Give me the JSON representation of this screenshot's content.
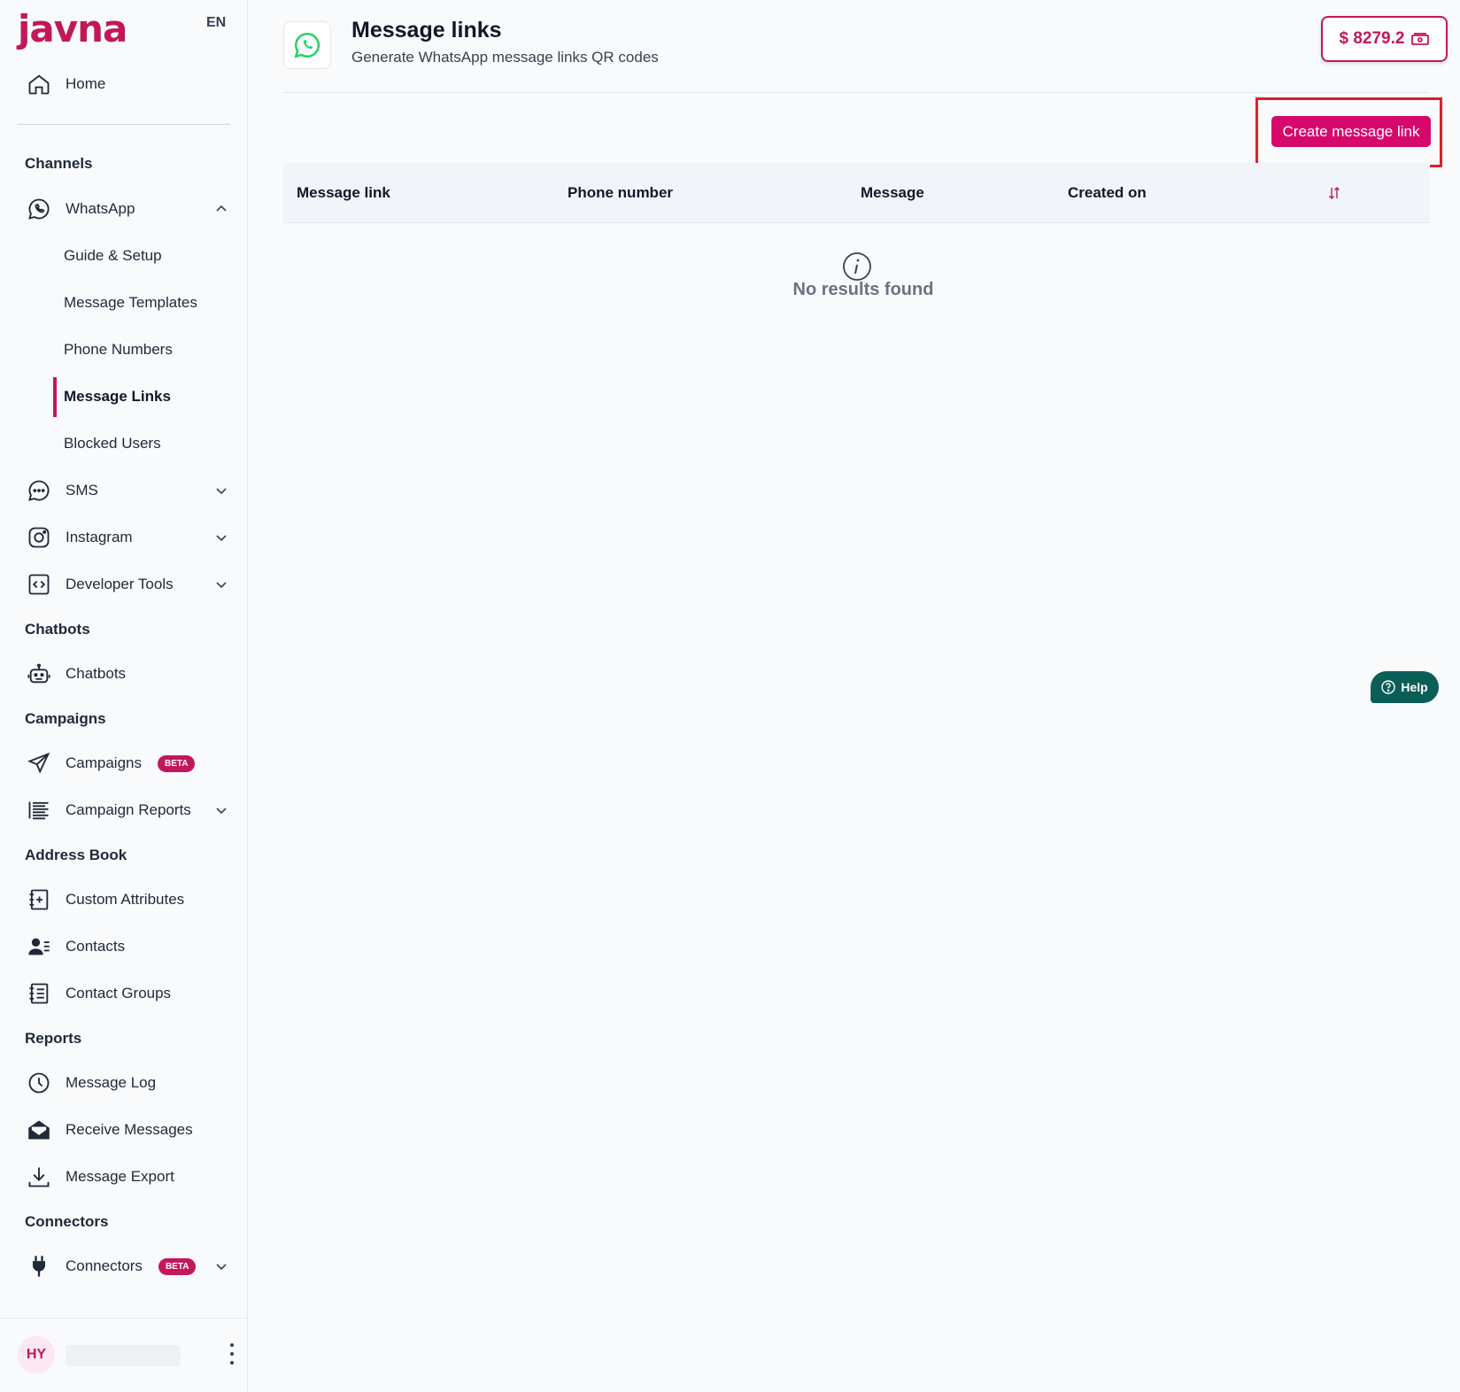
{
  "brand": {
    "logo": "javna",
    "language": "EN",
    "accent": "#c2185b"
  },
  "sidebar": {
    "home": "Home",
    "sections": {
      "channels": "Channels",
      "chatbots": "Chatbots",
      "campaigns": "Campaigns",
      "address_book": "Address Book",
      "reports": "Reports",
      "connectors": "Connectors"
    },
    "whatsapp": {
      "label": "WhatsApp",
      "expanded": true,
      "children": [
        "Guide & Setup",
        "Message Templates",
        "Phone Numbers",
        "Message Links",
        "Blocked Users"
      ],
      "active_child": "Message Links"
    },
    "sms": "SMS",
    "instagram": "Instagram",
    "developer_tools": "Developer Tools",
    "chatbots": "Chatbots",
    "campaigns": {
      "label": "Campaigns",
      "badge": "BETA"
    },
    "campaign_reports": "Campaign Reports",
    "custom_attributes": "Custom Attributes",
    "contacts": "Contacts",
    "contact_groups": "Contact Groups",
    "message_log": "Message Log",
    "receive_messages": "Receive Messages",
    "message_export": "Message Export",
    "connectors": {
      "label": "Connectors",
      "badge": "BETA"
    },
    "user": {
      "initials": "HY"
    }
  },
  "header": {
    "title": "Message links",
    "subtitle": "Generate WhatsApp message links QR codes",
    "balance": "$ 8279.2"
  },
  "toolbar": {
    "create_label": "Create message link"
  },
  "table": {
    "columns": [
      "Message link",
      "Phone number",
      "Message",
      "Created on"
    ],
    "rows": [],
    "empty_text": "No results found"
  },
  "help": {
    "label": "Help"
  }
}
